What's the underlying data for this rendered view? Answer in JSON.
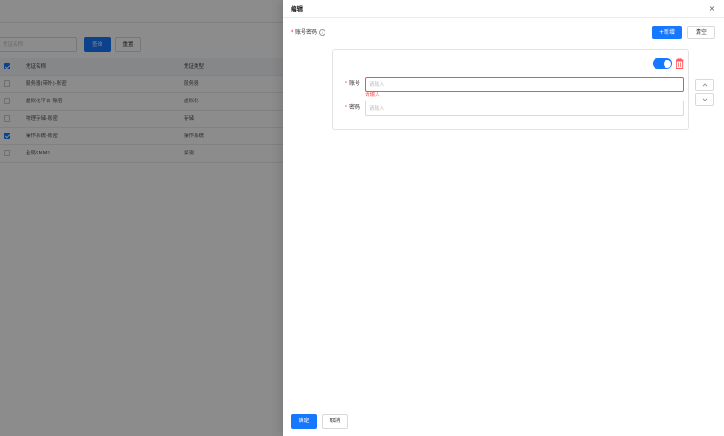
{
  "background": {
    "search": {
      "placeholder": "凭证名称"
    },
    "buttons": {
      "query": "查询",
      "reset": "重置"
    },
    "table": {
      "headers": [
        "凭证名称",
        "凭证类型"
      ],
      "rows": [
        {
          "name": "服务器(带外)-账密",
          "type": "服务器",
          "checked": false
        },
        {
          "name": "虚拟化平台-账密",
          "type": "虚拟化",
          "checked": false
        },
        {
          "name": "物理存储-账密",
          "type": "存储",
          "checked": false
        },
        {
          "name": "操作系统-账密",
          "type": "操作系统",
          "checked": true
        },
        {
          "name": "全局SNMP",
          "type": "探测",
          "checked": false
        }
      ]
    }
  },
  "drawer": {
    "title": "编辑",
    "close_symbol": "×",
    "field_label": "账号密码",
    "required_mark": "*",
    "add_button": "+新增",
    "clear_button": "清空",
    "card": {
      "enabled": true,
      "account_label": "账号",
      "account_placeholder": "请输入",
      "account_error": "请输入",
      "password_label": "密码",
      "password_placeholder": "请输入"
    },
    "footer": {
      "ok": "确定",
      "cancel": "取消"
    }
  },
  "colors": {
    "primary": "#1677ff",
    "error": "#ff4d4f",
    "overlay": "rgba(0,0,0,0.45)"
  },
  "icons": [
    "info-icon",
    "close-icon",
    "delete-icon",
    "chevron-up-icon",
    "chevron-down-icon",
    "checkbox-icon"
  ]
}
